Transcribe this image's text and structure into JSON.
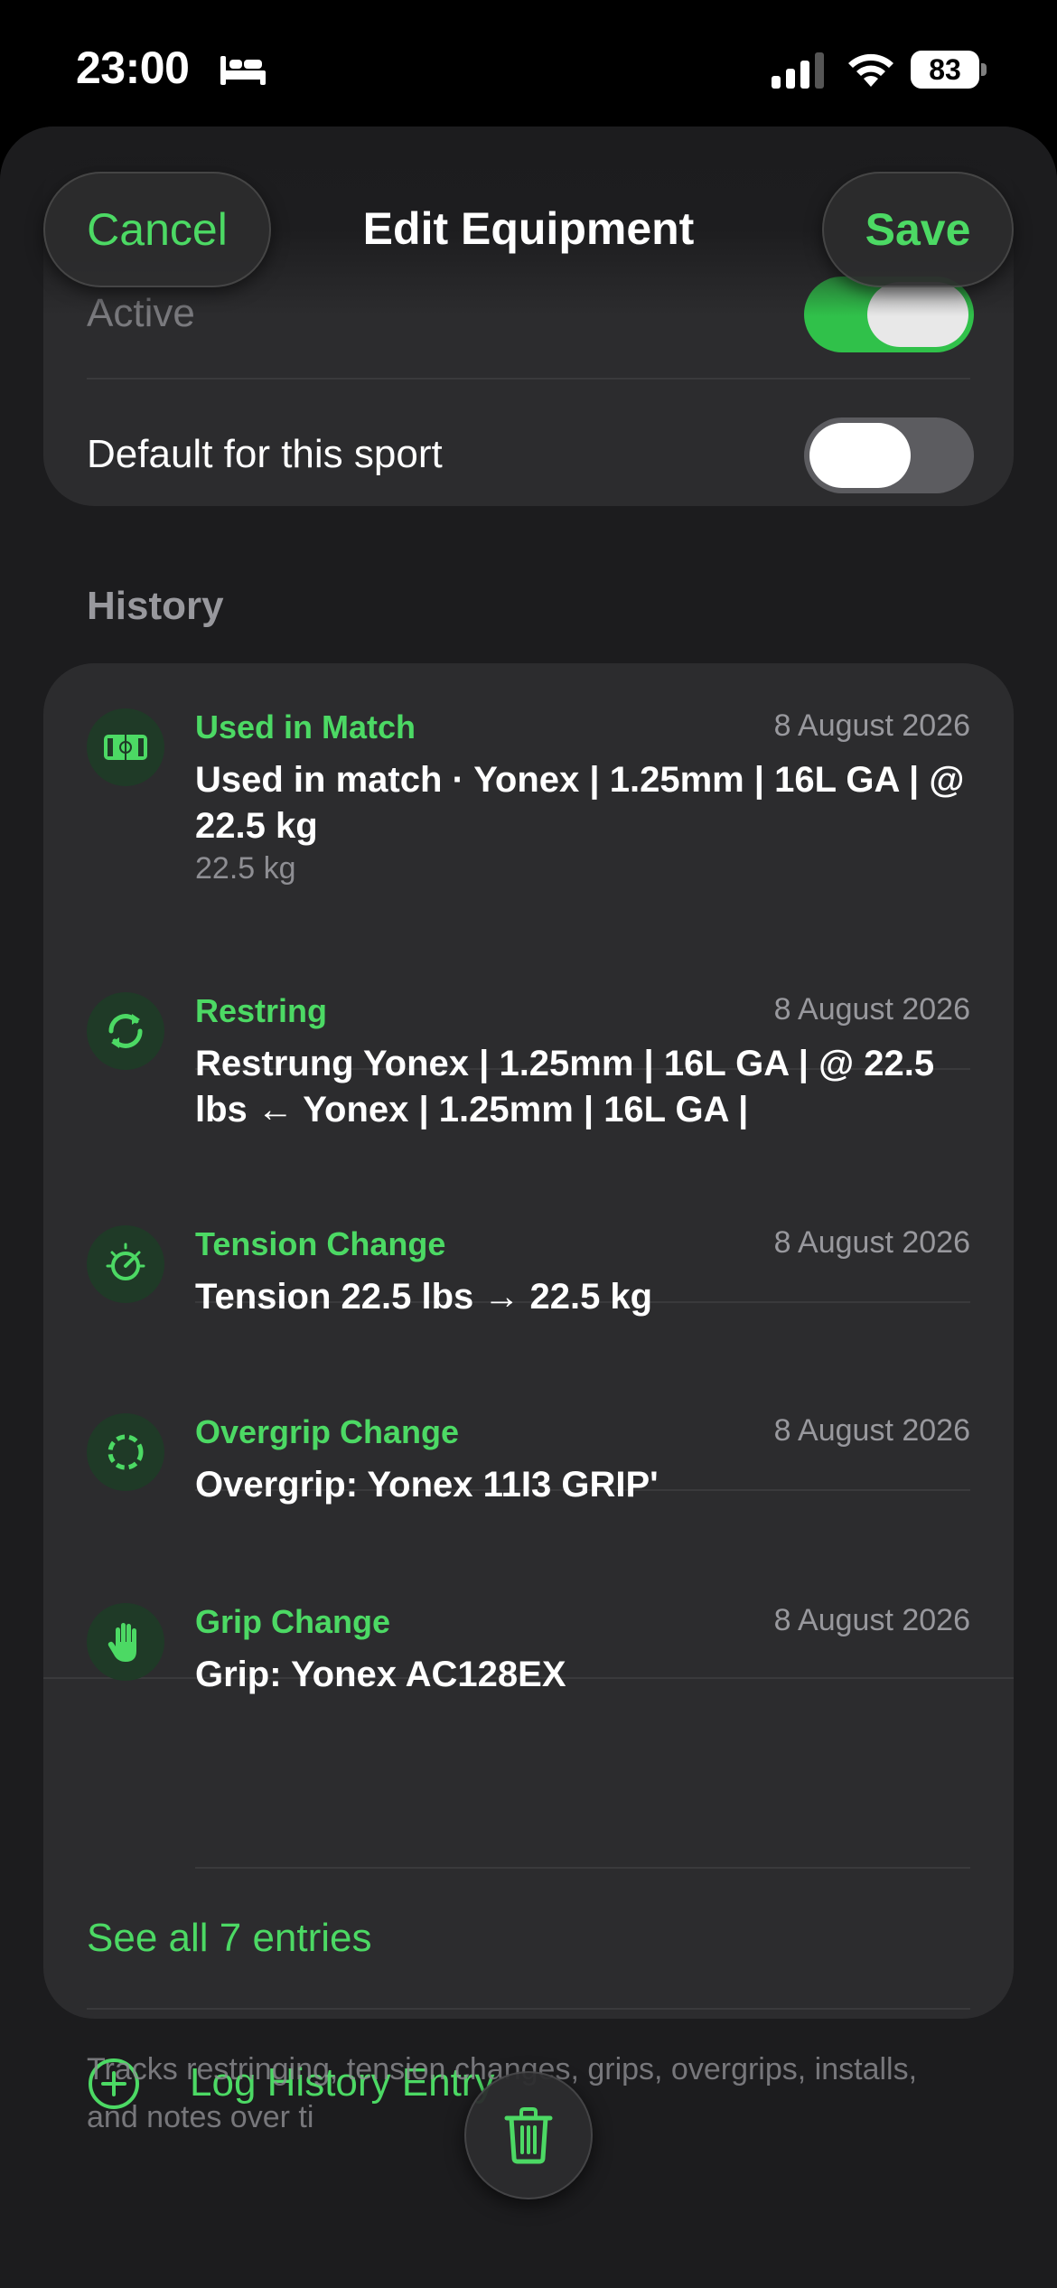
{
  "status_bar": {
    "time": "23:00",
    "focus_icon": "bed-icon",
    "battery_level": "83",
    "icons": [
      "signal-icon",
      "wifi-icon",
      "battery-icon"
    ]
  },
  "nav": {
    "cancel_label": "Cancel",
    "title": "Edit Equipment",
    "save_label": "Save"
  },
  "status_section": {
    "active_label": "Active",
    "active_on": true,
    "default_label": "Default for this sport",
    "default_on": false
  },
  "history": {
    "header": "History",
    "entries": [
      {
        "icon": "court-icon",
        "type": "Used in Match",
        "date": "8 August 2026",
        "description": "Used in match · Yonex | 1.25mm | 16L GA | @ 22.5 kg",
        "subtext": "22.5 kg"
      },
      {
        "icon": "restring-icon",
        "type": "Restring",
        "date": "8 August 2026",
        "description": "Restrung Yonex | 1.25mm | 16L GA | @ 22.5 lbs ← Yonex | 1.25mm | 16L GA |"
      },
      {
        "icon": "tension-gauge-icon",
        "type": "Tension Change",
        "date": "8 August 2026",
        "description": "Tension 22.5 lbs → 22.5 kg"
      },
      {
        "icon": "overgrip-ring-icon",
        "type": "Overgrip Change",
        "date": "8 August 2026",
        "description": "Overgrip: Yonex 11I3 GRIP'"
      },
      {
        "icon": "hand-icon",
        "type": "Grip Change",
        "date": "8 August 2026",
        "description": "Grip: Yonex AC128EX"
      }
    ],
    "see_all_label": "See all 7 entries",
    "log_entry_label": "Log History Entry",
    "footer": "Tracks restringing, tension changes, grips, overgrips, installs, and notes over ti"
  },
  "colors": {
    "accent": "#4cd964",
    "background": "#1c1c1e",
    "card": "#2c2c2e",
    "secondary_text": "#98989d"
  }
}
